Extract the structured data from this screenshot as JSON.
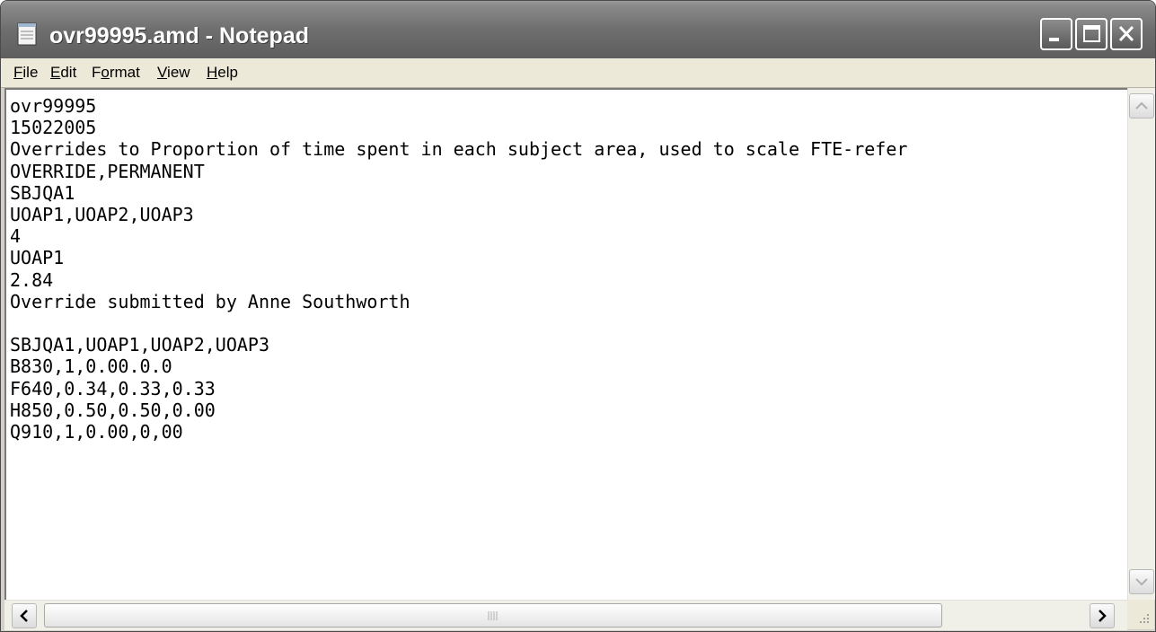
{
  "window": {
    "title": "ovr99995.amd - Notepad",
    "controls": {
      "minimize": "minimize-icon",
      "maximize": "maximize-icon",
      "close": "close-icon"
    }
  },
  "menu": {
    "file": {
      "mnemonic": "F",
      "rest": "ile"
    },
    "edit": {
      "mnemonic": "E",
      "rest": "dit"
    },
    "format": {
      "pre": "F",
      "mnemonic": "o",
      "rest": "rmat"
    },
    "view": {
      "mnemonic": "V",
      "rest": "iew"
    },
    "help": {
      "mnemonic": "H",
      "rest": "elp"
    }
  },
  "document": {
    "content": "ovr99995\n15022005\nOverrides to Proportion of time spent in each subject area, used to scale FTE-refer\nOVERRIDE,PERMANENT\nSBJQA1\nUOAP1,UOAP2,UOAP3\n4\nUOAP1\n2.84\nOverride submitted by Anne Southworth\n\nSBJQA1,UOAP1,UOAP2,UOAP3\nB830,1,0.00.0.0\nF640,0.34,0.33,0.33\nH850,0.50,0.50,0.00\nQ910,1,0.00,0,00"
  },
  "colors": {
    "titlebar": "#6e6e6e",
    "menubar": "#ece9d8",
    "editor_bg": "#ffffff",
    "text": "#000000"
  }
}
